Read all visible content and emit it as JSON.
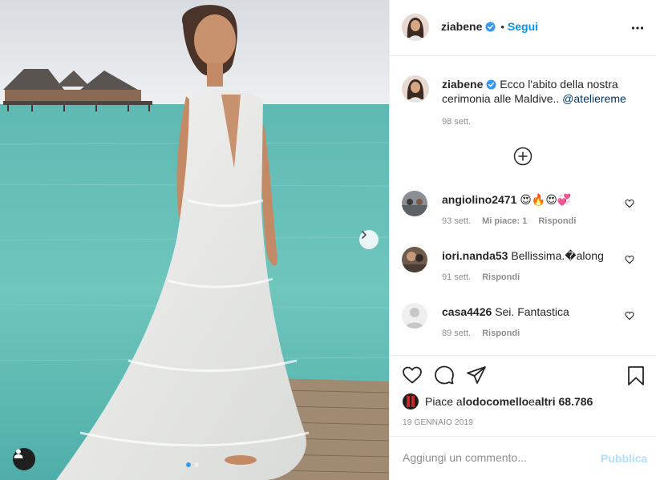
{
  "post": {
    "username": "ziabene",
    "verified_icon": "verified-badge-icon",
    "follow_separator": "•",
    "follow_label": "Segui",
    "more_icon": "more-options-icon"
  },
  "photo": {
    "next_icon": "chevron-right-icon",
    "user_tag_icon": "user-tag-icon",
    "carousel_count": 2,
    "carousel_active": 1
  },
  "caption": {
    "username": "ziabene",
    "text": "Ecco l'abito della nostra cerimonia alle Maldive..",
    "mention": "@ateliereme",
    "time": "98 sett."
  },
  "load_more_icon": "plus-circle-icon",
  "comments": [
    {
      "username": "angiolino2471",
      "text": "😍🔥😍💞",
      "time": "93 sett.",
      "likes": "Mi piace: 1",
      "reply": "Rispondi"
    },
    {
      "username": "iori.nanda53",
      "text": "Bellissima.�along",
      "time": "91 sett.",
      "likes": "",
      "reply": "Rispondi"
    },
    {
      "username": "casa4426",
      "text": "Sei. Fantastica",
      "time": "89 sett.",
      "likes": "",
      "reply": "Rispondi"
    }
  ],
  "actions": {
    "like_icon": "heart-icon",
    "comment_icon": "comment-icon",
    "share_icon": "share-icon",
    "save_icon": "bookmark-icon"
  },
  "likes": {
    "prefix": "Piace a ",
    "user": "lodocomello",
    "middle": " e ",
    "others": "altri 68.786"
  },
  "date": "19 GENNAIO 2019",
  "add_comment": {
    "placeholder": "Aggiungi un commento...",
    "publish_label": "Pubblica"
  },
  "colors": {
    "link_blue": "#0095f6",
    "mention_blue": "#00376b",
    "publish_disabled": "#b2dffc",
    "verified_blue": "#3897f0",
    "muted": "#8e8e8e"
  }
}
